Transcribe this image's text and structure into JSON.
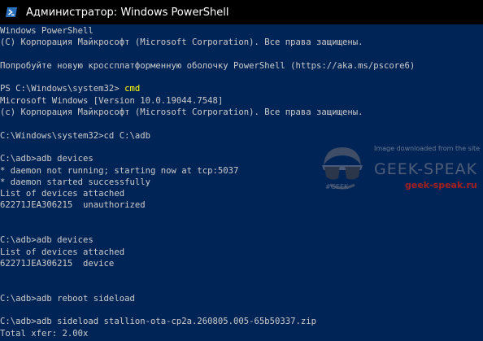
{
  "window": {
    "title": "Администратор: Windows PowerShell",
    "icon": "powershell-icon",
    "background_color": "#012456",
    "text_color": "#cccccc",
    "command_color": "#ffff00"
  },
  "console": {
    "lines": [
      {
        "text": "Windows PowerShell"
      },
      {
        "text": "(C) Корпорация Майкрософт (Microsoft Corporation). Все права защищены."
      },
      {
        "text": ""
      },
      {
        "text": "Попробуйте новую кроссплатформенную оболочку PowerShell (https://aka.ms/pscore6)"
      },
      {
        "text": ""
      },
      {
        "prompt": "PS C:\\Windows\\system32> ",
        "command": "cmd"
      },
      {
        "text": "Microsoft Windows [Version 10.0.19044.7548]"
      },
      {
        "text": "(c) Корпорация Майкрософт (Microsoft Corporation). Все права защищены."
      },
      {
        "text": ""
      },
      {
        "text": "C:\\Windows\\system32>cd C:\\adb"
      },
      {
        "text": ""
      },
      {
        "text": "C:\\adb>adb devices"
      },
      {
        "text": "* daemon not running; starting now at tcp:5037"
      },
      {
        "text": "* daemon started successfully"
      },
      {
        "text": "List of devices attached"
      },
      {
        "text": "62271JEA306215  unauthorized"
      },
      {
        "text": ""
      },
      {
        "text": ""
      },
      {
        "text": "C:\\adb>adb devices"
      },
      {
        "text": "List of devices attached"
      },
      {
        "text": "62271JEA306215  device"
      },
      {
        "text": ""
      },
      {
        "text": ""
      },
      {
        "text": "C:\\adb>adb reboot sideload"
      },
      {
        "text": ""
      },
      {
        "text": "C:\\adb>adb sideload stallion-ota-cp2a.260805.005-65b50337.zip"
      },
      {
        "text": "Total xfer: 2.00x"
      }
    ]
  },
  "watermark": {
    "top_text": "Image downloaded from the site",
    "brand": "GEEK-SPEAK",
    "site": "geek-speak.ru",
    "tag": "#GEEK",
    "logo_icon": "geek-sunglasses-icon"
  }
}
